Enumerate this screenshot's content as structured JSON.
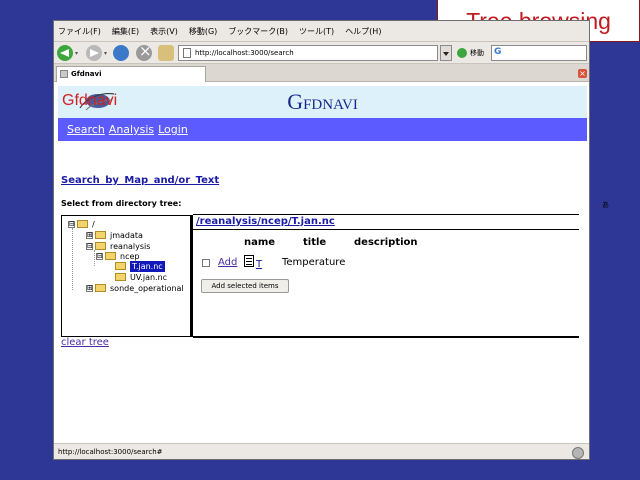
{
  "slide_title": "Tree browsing",
  "stray_char": "あ",
  "menu": [
    "ファイル(F)",
    "編集(E)",
    "表示(V)",
    "移動(G)",
    "ブックマーク(B)",
    "ツール(T)",
    "ヘルプ(H)"
  ],
  "navigation": {
    "url": "http://localhost:3000/search",
    "go_label": "移動",
    "search_logo": "G"
  },
  "tab": {
    "title": "Gfdnavi"
  },
  "page": {
    "logo": "Gfdnavi",
    "site_title": "Gfdnavi",
    "nav_links": [
      "Search",
      "Analysis",
      "Login"
    ],
    "search_link": "Search by Map and/or Text",
    "select_label": "Select from directory tree:",
    "tree": [
      {
        "label": "/",
        "expander": "⊟"
      },
      {
        "label": "jmadata",
        "expander": "⊞"
      },
      {
        "label": "reanalysis",
        "expander": "⊟"
      },
      {
        "label": "ncep",
        "expander": "⊟"
      },
      {
        "label": "T.jan.nc",
        "expander": ""
      },
      {
        "label": "UV.jan.nc",
        "expander": ""
      },
      {
        "label": "sonde_operational",
        "expander": "⊞"
      }
    ],
    "path_link": "/reanalysis/ncep/T.jan.nc",
    "columns": [
      "name",
      "title",
      "description"
    ],
    "row": {
      "add": "Add",
      "name": "T",
      "title": "Temperature"
    },
    "add_button": "Add selected items",
    "clear_tree": "clear tree"
  },
  "status": {
    "text": "http://localhost:3000/search#"
  }
}
